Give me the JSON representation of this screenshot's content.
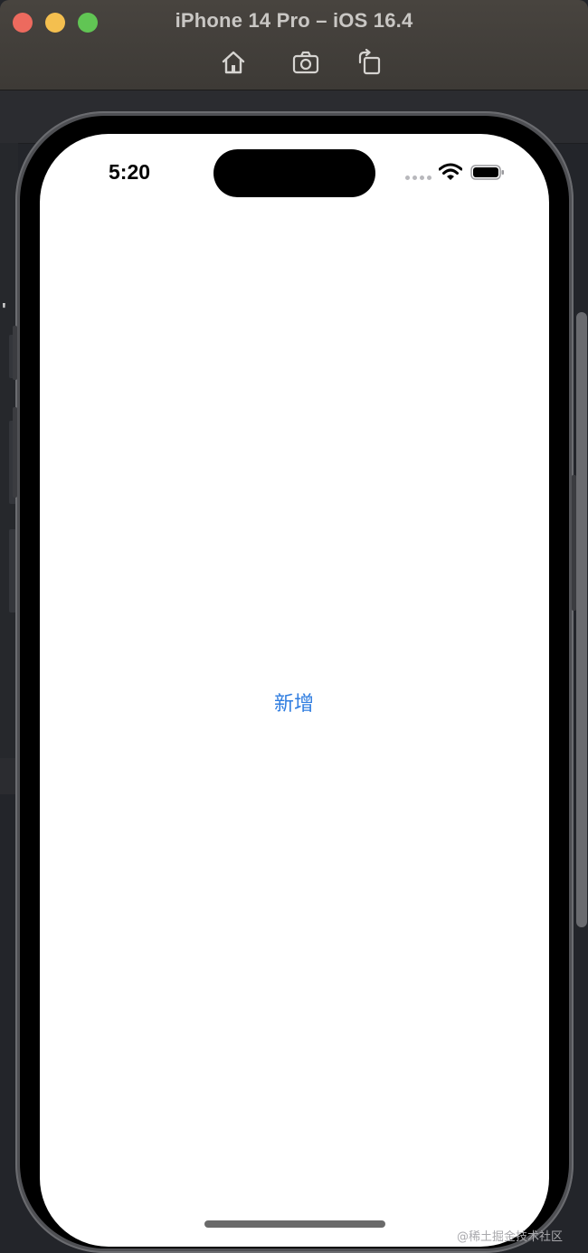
{
  "window": {
    "title": "iPhone 14 Pro – iOS 16.4",
    "toolbar": {
      "home_icon": "home-icon",
      "screenshot_icon": "camera-icon",
      "rotate_icon": "rotate-icon"
    }
  },
  "background": {
    "tick_char": "'"
  },
  "device": {
    "status_bar": {
      "time": "5:20",
      "signal_icon": "cellular-dots-icon",
      "wifi_icon": "wifi-icon",
      "battery_icon": "battery-icon"
    },
    "content": {
      "add_button_label": "新增"
    }
  },
  "watermark": "@稀土掘金技术社区",
  "colors": {
    "accent": "#2f7de0",
    "close": "#ed6a5e",
    "minimize": "#f4bf4f",
    "maximize": "#61c554"
  }
}
